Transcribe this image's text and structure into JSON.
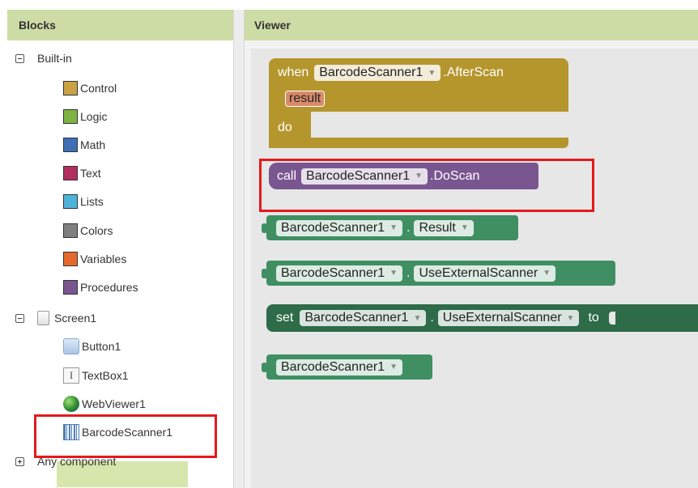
{
  "blocks_panel": {
    "title": "Blocks",
    "builtin_label": "Built-in",
    "builtin_items": [
      {
        "label": "Control",
        "color": "#c9a344"
      },
      {
        "label": "Logic",
        "color": "#7cb342"
      },
      {
        "label": "Math",
        "color": "#3f6fb5"
      },
      {
        "label": "Text",
        "color": "#b32d5e"
      },
      {
        "label": "Lists",
        "color": "#4fb3d9"
      },
      {
        "label": "Colors",
        "color": "#7f7f7f"
      },
      {
        "label": "Variables",
        "color": "#e46a2c"
      },
      {
        "label": "Procedures",
        "color": "#7a5691"
      }
    ],
    "screen_label": "Screen1",
    "components": [
      {
        "label": "Button1",
        "icon": "button-icon"
      },
      {
        "label": "TextBox1",
        "icon": "textbox-icon"
      },
      {
        "label": "WebViewer1",
        "icon": "globe-icon"
      },
      {
        "label": "BarcodeScanner1",
        "icon": "barcode-icon"
      }
    ],
    "any_component_label": "Any component"
  },
  "viewer": {
    "title": "Viewer",
    "event_block": {
      "when": "when",
      "component": "BarcodeScanner1",
      "event": ".AfterScan",
      "param": "result",
      "do": "do",
      "color": "#b5962d"
    },
    "call_block": {
      "call": "call",
      "component": "BarcodeScanner1",
      "method": ".DoScan",
      "color": "#7a5691"
    },
    "getter_result": {
      "component": "BarcodeScanner1",
      "property": "Result",
      "color": "#3f8f63"
    },
    "getter_external": {
      "component": "BarcodeScanner1",
      "property": "UseExternalScanner",
      "color": "#3f8f63"
    },
    "setter_block": {
      "set": "set",
      "component": "BarcodeScanner1",
      "property": "UseExternalScanner",
      "to": "to",
      "color": "#2e6b49"
    },
    "component_block": {
      "component": "BarcodeScanner1",
      "color": "#3f8f63"
    }
  },
  "highlight_color": "#e5191c"
}
